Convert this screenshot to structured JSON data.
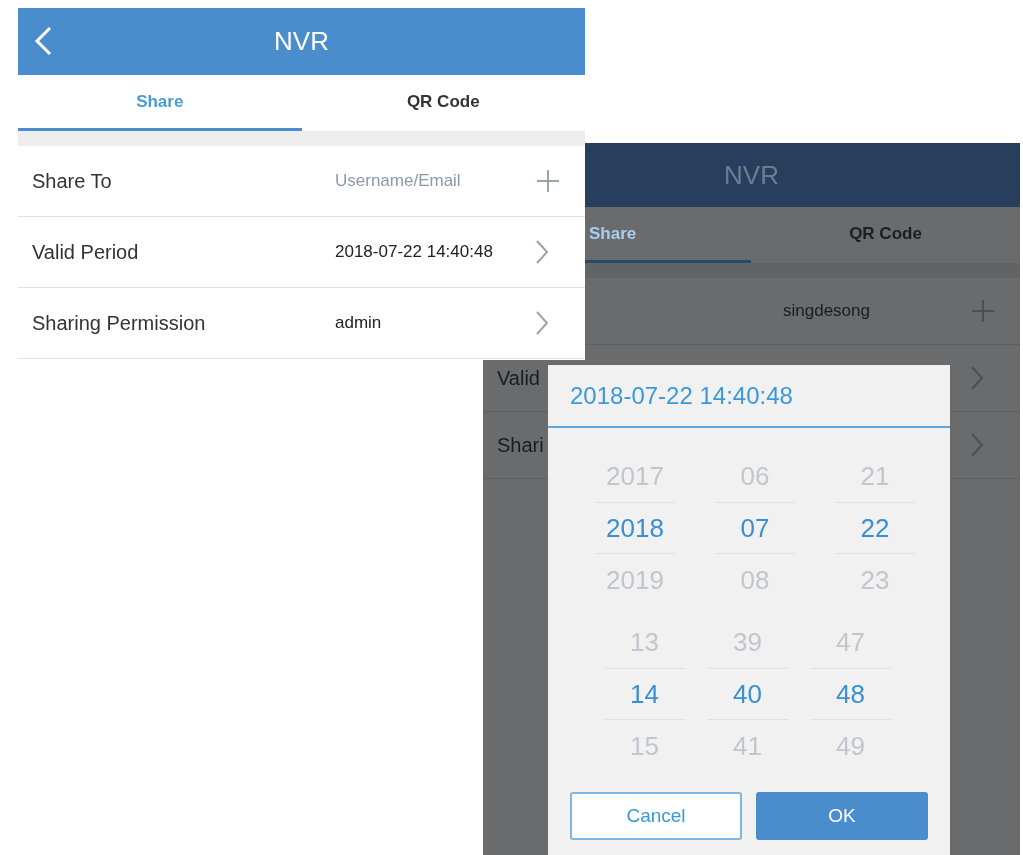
{
  "screens": [
    {
      "dimmed": false,
      "header": {
        "title": "NVR",
        "back": true
      },
      "tabs": [
        {
          "label": "Share",
          "selected": true
        },
        {
          "label": "QR Code",
          "selected": false
        }
      ],
      "rows": [
        {
          "kind": "add",
          "label": "Share To",
          "placeholder": "Username/Email"
        },
        {
          "kind": "link",
          "label": "Valid Period",
          "value": "2018-07-22 14:40:48"
        },
        {
          "kind": "link",
          "label": "Sharing Permission",
          "value": "admin"
        }
      ]
    },
    {
      "dimmed": true,
      "header": {
        "title": "NVR"
      },
      "tabs": [
        {
          "label": "Share",
          "selected": true
        },
        {
          "label": "QR Code",
          "selected": false
        }
      ],
      "rows": [
        {
          "kind": "add",
          "value": "singdesong"
        },
        {
          "kind": "link",
          "label": "Valid"
        },
        {
          "kind": "link",
          "label": "Shari"
        }
      ]
    }
  ],
  "dialog": {
    "title": "2018-07-22 14:40:48",
    "date_columns": [
      [
        {
          "text": "2017",
          "selected": false
        },
        {
          "text": "2018",
          "selected": true
        },
        {
          "text": "2019",
          "selected": false
        }
      ],
      [
        {
          "text": "06",
          "selected": false
        },
        {
          "text": "07",
          "selected": true
        },
        {
          "text": "08",
          "selected": false
        }
      ],
      [
        {
          "text": "21",
          "selected": false
        },
        {
          "text": "22",
          "selected": true
        },
        {
          "text": "23",
          "selected": false
        }
      ]
    ],
    "time_columns": [
      [
        {
          "text": "13",
          "selected": false
        },
        {
          "text": "14",
          "selected": true
        },
        {
          "text": "15",
          "selected": false
        }
      ],
      [
        {
          "text": "39",
          "selected": false
        },
        {
          "text": "40",
          "selected": true
        },
        {
          "text": "41",
          "selected": false
        }
      ],
      [
        {
          "text": "47",
          "selected": false
        },
        {
          "text": "48",
          "selected": true
        },
        {
          "text": "49",
          "selected": false
        }
      ]
    ],
    "buttons": [
      {
        "kind": "secondary",
        "label": "Cancel"
      },
      {
        "kind": "primary",
        "label": "OK"
      }
    ]
  }
}
